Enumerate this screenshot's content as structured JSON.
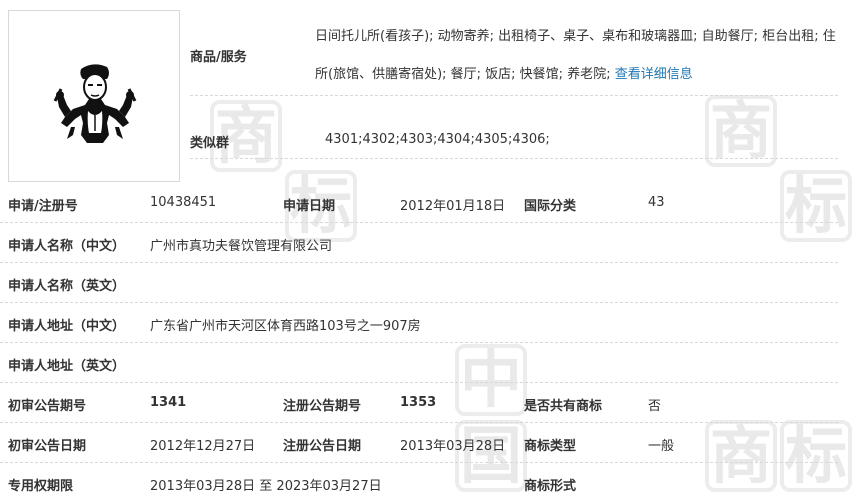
{
  "logo": {
    "alt_icon": "kungfu-figure-logo"
  },
  "goods_services": {
    "label": "商品/服务",
    "text": "日间托儿所(看孩子); 动物寄养; 出租椅子、桌子、桌布和玻璃器皿; 自助餐厅; 柜台出租; 住所(旅馆、供膳寄宿处); 餐厅; 饭店; 快餐馆; 养老院;",
    "link": "查看详细信息"
  },
  "similar_group": {
    "label": "类似群",
    "value": "4301;4302;4303;4304;4305;4306;"
  },
  "rows": {
    "reg_no": {
      "label": "申请/注册号",
      "value": "10438451"
    },
    "apply_date": {
      "label": "申请日期",
      "value": "2012年01月18日"
    },
    "intl_class": {
      "label": "国际分类",
      "value": "43"
    },
    "applicant_cn": {
      "label": "申请人名称（中文）",
      "value": "广州市真功夫餐饮管理有限公司"
    },
    "applicant_en": {
      "label": "申请人名称（英文）",
      "value": ""
    },
    "address_cn": {
      "label": "申请人地址（中文）",
      "value": "广东省广州市天河区体育西路103号之一907房"
    },
    "address_en": {
      "label": "申请人地址（英文）",
      "value": ""
    },
    "prelim_no": {
      "label": "初审公告期号",
      "value": "1341"
    },
    "reg_pub_no": {
      "label": "注册公告期号",
      "value": "1353"
    },
    "shared": {
      "label": "是否共有商标",
      "value": "否"
    },
    "prelim_date": {
      "label": "初审公告日期",
      "value": "2012年12月27日"
    },
    "reg_pub_date": {
      "label": "注册公告日期",
      "value": "2013年03月28日"
    },
    "mark_type": {
      "label": "商标类型",
      "value": "一般"
    },
    "exclusive_period": {
      "label": "专用权期限",
      "value": "2013年03月28日 至 2023年03月27日"
    },
    "mark_form": {
      "label": "商标形式",
      "value": ""
    }
  },
  "watermark": [
    "中",
    "国",
    "商",
    "标",
    "商",
    "标"
  ]
}
